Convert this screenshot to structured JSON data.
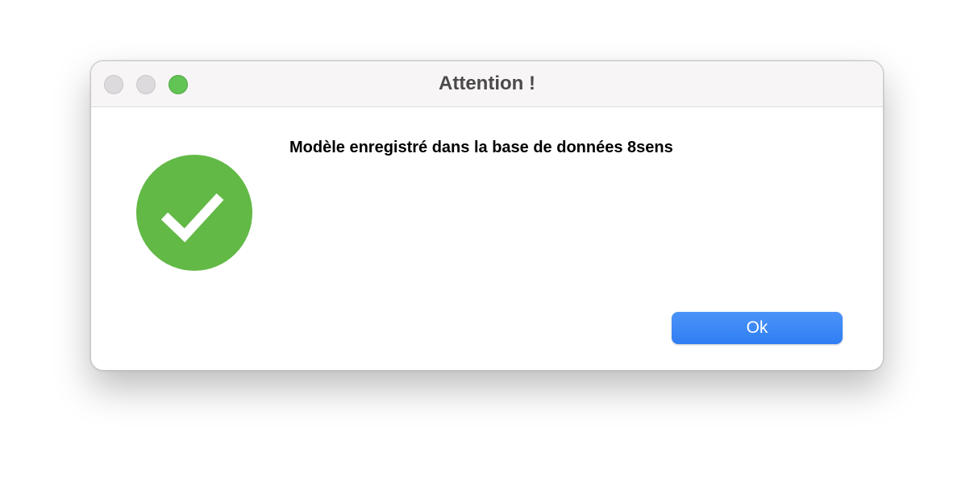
{
  "window": {
    "title": "Attention !",
    "traffic_lights": [
      "close",
      "minimize",
      "zoom"
    ]
  },
  "dialog": {
    "icon": "success-checkmark-icon",
    "message": "Modèle enregistré dans la base de données 8sens",
    "ok_label": "Ok"
  },
  "colors": {
    "success_green": "#62b946",
    "button_blue": "#3a86f5",
    "zoom_green": "#62c454"
  }
}
